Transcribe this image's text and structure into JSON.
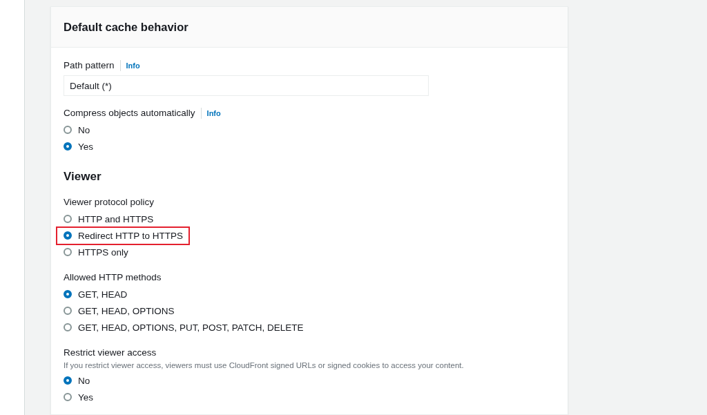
{
  "card": {
    "title": "Default cache behavior",
    "sections": [
      {
        "kind": "text-field",
        "label": "Path pattern",
        "info": "Info",
        "value": "Default (*)"
      },
      {
        "kind": "radio-group",
        "label": "Compress objects automatically",
        "info": "Info",
        "options": [
          {
            "label": "No",
            "selected": false
          },
          {
            "label": "Yes",
            "selected": true
          }
        ]
      },
      {
        "kind": "heading",
        "text": "Viewer"
      },
      {
        "kind": "radio-group",
        "label": "Viewer protocol policy",
        "options": [
          {
            "label": "HTTP and HTTPS",
            "selected": false
          },
          {
            "label": "Redirect HTTP to HTTPS",
            "selected": true,
            "highlighted": true
          },
          {
            "label": "HTTPS only",
            "selected": false
          }
        ]
      },
      {
        "kind": "radio-group",
        "label": "Allowed HTTP methods",
        "options": [
          {
            "label": "GET, HEAD",
            "selected": true
          },
          {
            "label": "GET, HEAD, OPTIONS",
            "selected": false
          },
          {
            "label": "GET, HEAD, OPTIONS, PUT, POST, PATCH, DELETE",
            "selected": false
          }
        ]
      },
      {
        "kind": "radio-group",
        "label": "Restrict viewer access",
        "description": "If you restrict viewer access, viewers must use CloudFront signed URLs or signed cookies to access your content.",
        "options": [
          {
            "label": "No",
            "selected": true
          },
          {
            "label": "Yes",
            "selected": false
          }
        ]
      }
    ]
  }
}
